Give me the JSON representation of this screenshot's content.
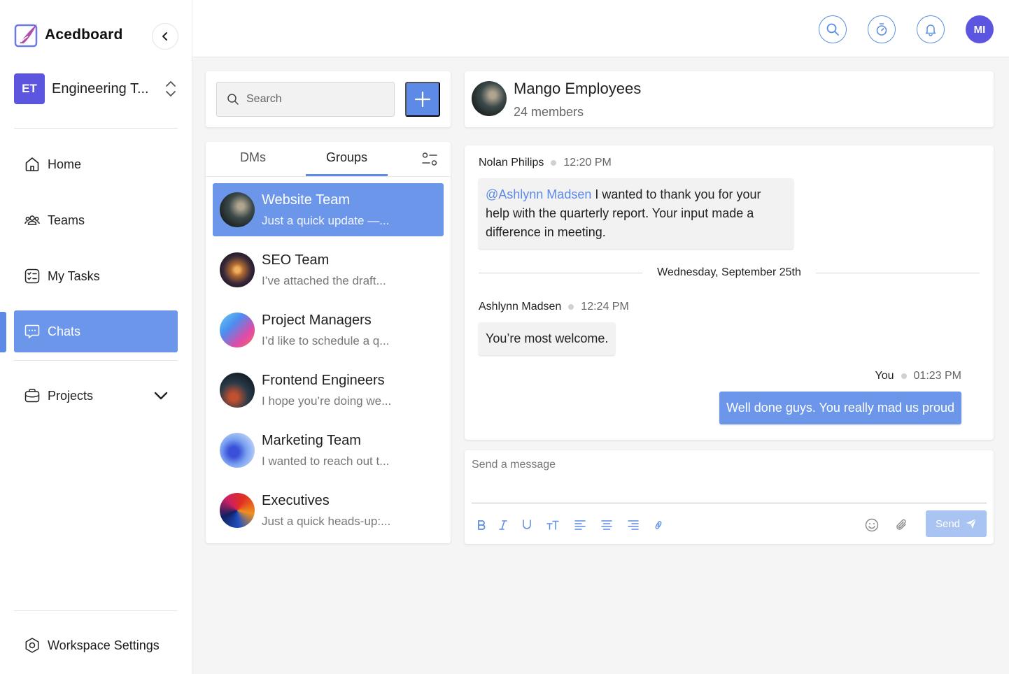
{
  "app": {
    "name": "Acedboard"
  },
  "workspace": {
    "initials": "ET",
    "name": "Engineering T..."
  },
  "nav": {
    "home": "Home",
    "teams": "Teams",
    "tasks": "My Tasks",
    "chats": "Chats",
    "projects": "Projects",
    "settings": "Workspace Settings"
  },
  "topbar": {
    "user_initials": "MI"
  },
  "search": {
    "placeholder": "Search"
  },
  "tabs": {
    "dms": "DMs",
    "groups": "Groups"
  },
  "conversations": [
    {
      "title": "Website Team",
      "preview": "Just a quick update —..."
    },
    {
      "title": "SEO Team",
      "preview": "I’ve attached the draft..."
    },
    {
      "title": "Project Managers",
      "preview": "I’d like to schedule a q..."
    },
    {
      "title": "Frontend Engineers",
      "preview": "I hope you’re doing we..."
    },
    {
      "title": "Marketing Team",
      "preview": "I wanted to reach out t..."
    },
    {
      "title": "Executives",
      "preview": "Just a quick heads-up:..."
    }
  ],
  "chat": {
    "group_name": "Mango Employees",
    "members": "24 members",
    "messages": [
      {
        "author": "Nolan Philips",
        "time": "12:20 PM",
        "mention": "@Ashlynn Madsen",
        "text": "I wanted to thank you for your help with the quarterly report. Your input made a difference in meeting."
      },
      {
        "author": "Ashlynn Madsen",
        "time": "12:24 PM",
        "text": "You’re most welcome."
      },
      {
        "author": "You",
        "time": "01:23 PM",
        "text": "Well done guys. You really mad us proud"
      }
    ],
    "date_separator": "Wednesday, September 25th"
  },
  "composer": {
    "placeholder": "Send a message",
    "send_label": "Send"
  },
  "colors": {
    "accent": "#5d8ae6",
    "active_bg": "#6b96ea",
    "workspace_badge": "#5b55e0",
    "send_disabled": "#a9c3f2"
  }
}
